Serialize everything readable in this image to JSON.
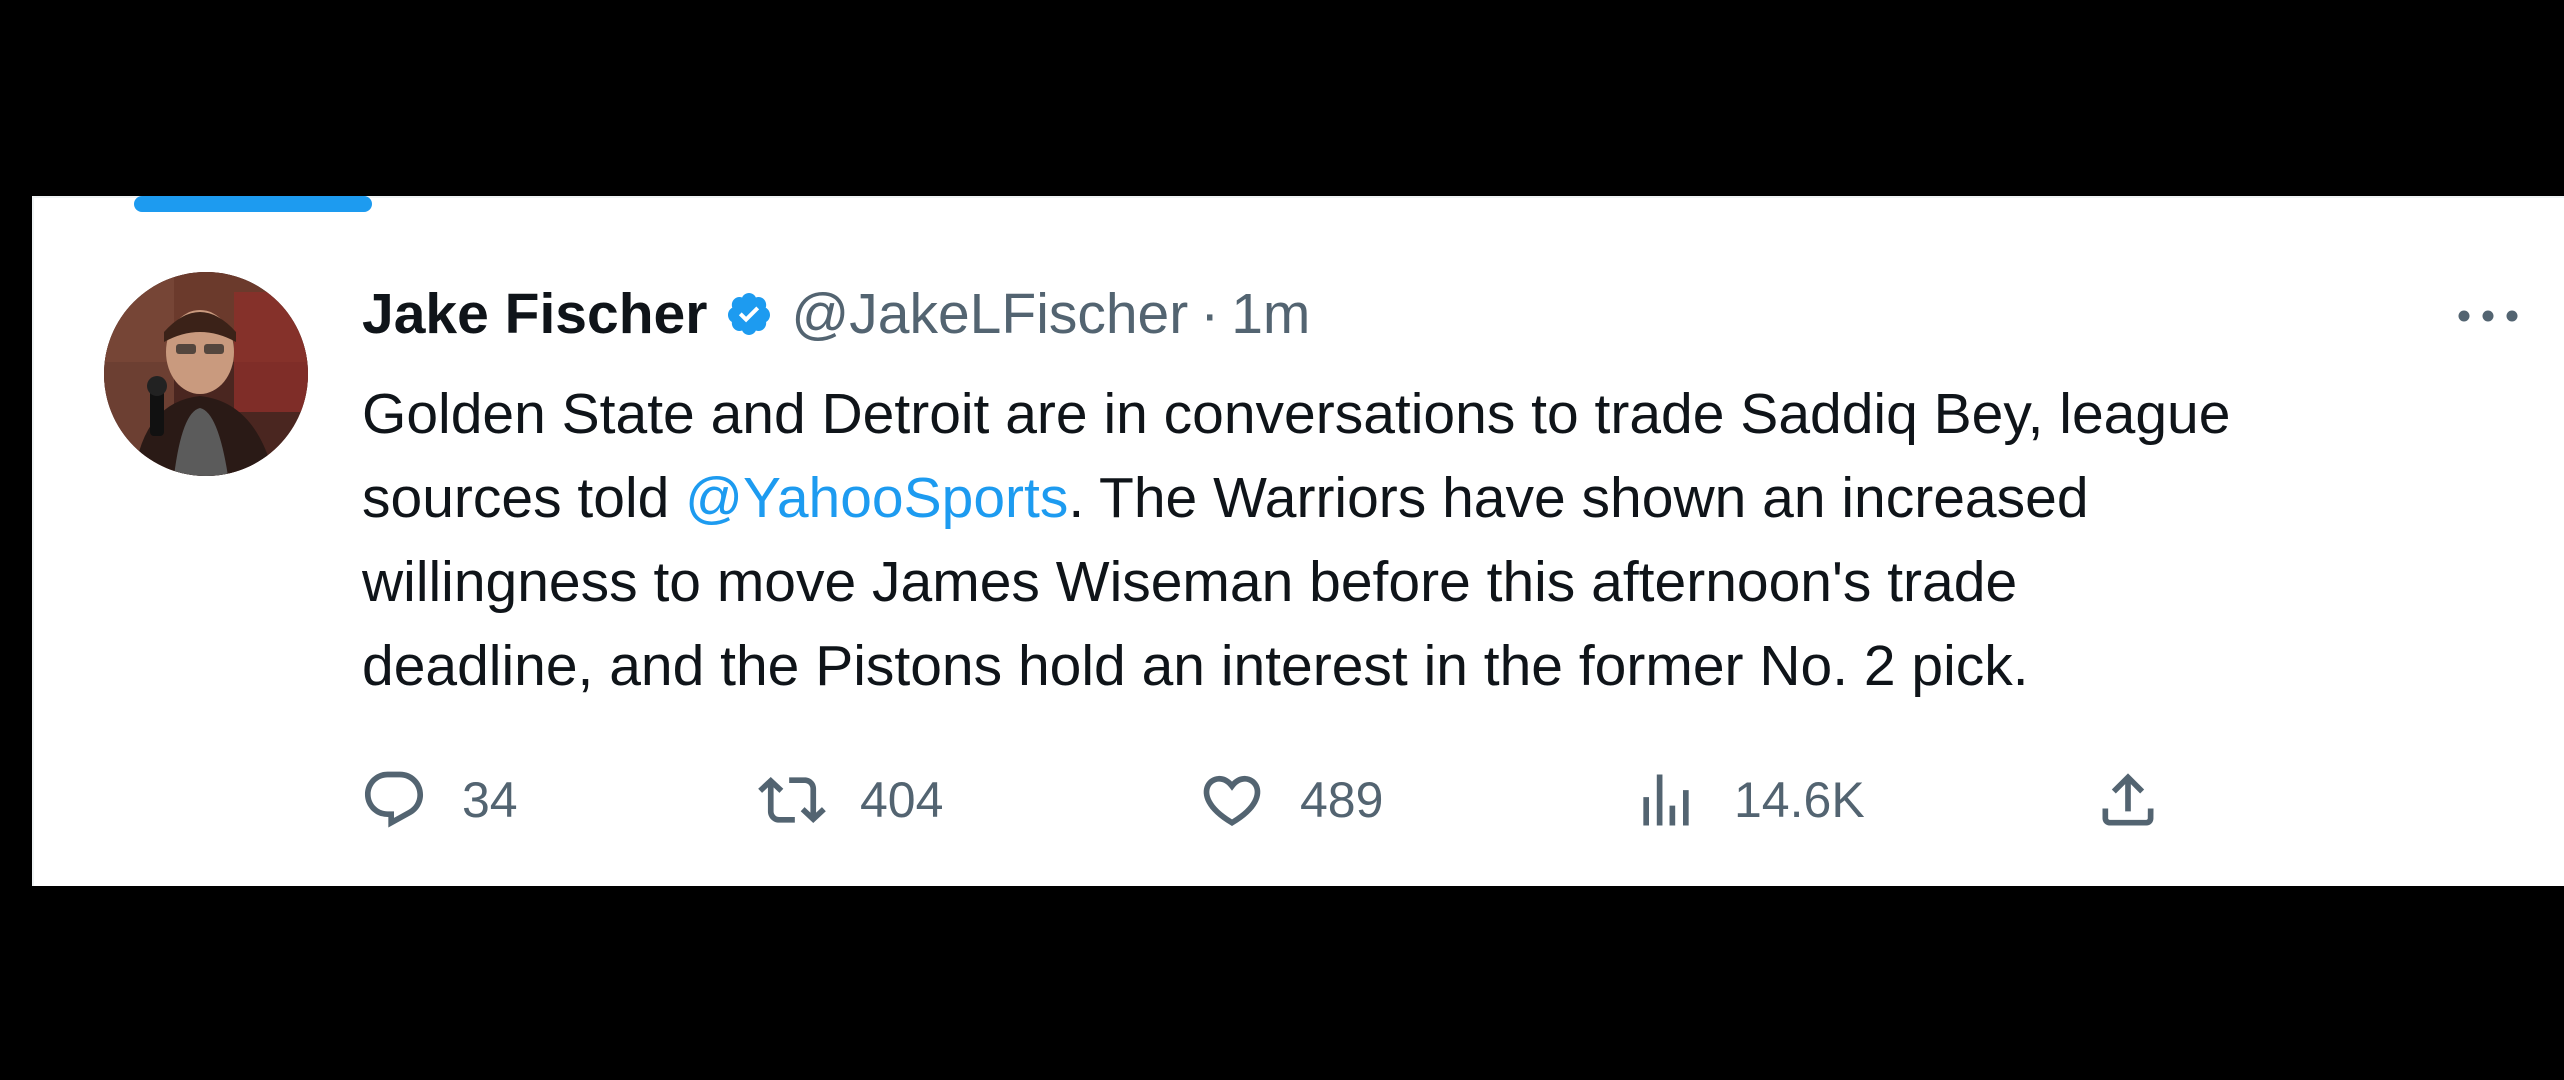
{
  "tweet": {
    "author": {
      "name": "Jake Fischer",
      "handle": "@JakeLFischer",
      "verified": true
    },
    "separator": "·",
    "timestamp": "1m",
    "text_before": "Golden State and Detroit are in conversations to trade Saddiq Bey, league\nsources told ",
    "mention": "@YahooSports",
    "text_after": ". The Warriors have shown an increased\nwillingness to move James Wiseman before this afternoon's trade\ndeadline, and the Pistons hold an interest in the former No. 2 pick.",
    "actions": {
      "reply_count": "34",
      "retweet_count": "404",
      "like_count": "489",
      "views_count": "14.6K"
    }
  },
  "colors": {
    "accent": "#1d9bf0",
    "text": "#0f1419",
    "muted": "#536471",
    "background": "#ffffff",
    "frame": "#000000"
  },
  "icons": [
    "verified-badge-icon",
    "more-options-icon",
    "reply-icon",
    "retweet-icon",
    "like-icon",
    "views-icon",
    "share-icon"
  ]
}
